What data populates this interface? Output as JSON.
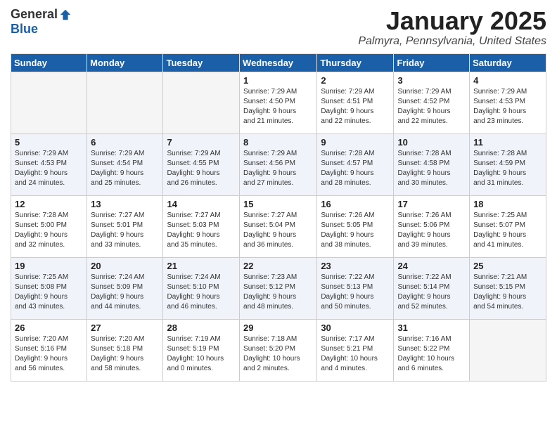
{
  "header": {
    "logo_general": "General",
    "logo_blue": "Blue",
    "month_title": "January 2025",
    "location": "Palmyra, Pennsylvania, United States"
  },
  "days_of_week": [
    "Sunday",
    "Monday",
    "Tuesday",
    "Wednesday",
    "Thursday",
    "Friday",
    "Saturday"
  ],
  "weeks": [
    {
      "shaded": false,
      "days": [
        {
          "num": "",
          "info": ""
        },
        {
          "num": "",
          "info": ""
        },
        {
          "num": "",
          "info": ""
        },
        {
          "num": "1",
          "info": "Sunrise: 7:29 AM\nSunset: 4:50 PM\nDaylight: 9 hours\nand 21 minutes."
        },
        {
          "num": "2",
          "info": "Sunrise: 7:29 AM\nSunset: 4:51 PM\nDaylight: 9 hours\nand 22 minutes."
        },
        {
          "num": "3",
          "info": "Sunrise: 7:29 AM\nSunset: 4:52 PM\nDaylight: 9 hours\nand 22 minutes."
        },
        {
          "num": "4",
          "info": "Sunrise: 7:29 AM\nSunset: 4:53 PM\nDaylight: 9 hours\nand 23 minutes."
        }
      ]
    },
    {
      "shaded": true,
      "days": [
        {
          "num": "5",
          "info": "Sunrise: 7:29 AM\nSunset: 4:53 PM\nDaylight: 9 hours\nand 24 minutes."
        },
        {
          "num": "6",
          "info": "Sunrise: 7:29 AM\nSunset: 4:54 PM\nDaylight: 9 hours\nand 25 minutes."
        },
        {
          "num": "7",
          "info": "Sunrise: 7:29 AM\nSunset: 4:55 PM\nDaylight: 9 hours\nand 26 minutes."
        },
        {
          "num": "8",
          "info": "Sunrise: 7:29 AM\nSunset: 4:56 PM\nDaylight: 9 hours\nand 27 minutes."
        },
        {
          "num": "9",
          "info": "Sunrise: 7:28 AM\nSunset: 4:57 PM\nDaylight: 9 hours\nand 28 minutes."
        },
        {
          "num": "10",
          "info": "Sunrise: 7:28 AM\nSunset: 4:58 PM\nDaylight: 9 hours\nand 30 minutes."
        },
        {
          "num": "11",
          "info": "Sunrise: 7:28 AM\nSunset: 4:59 PM\nDaylight: 9 hours\nand 31 minutes."
        }
      ]
    },
    {
      "shaded": false,
      "days": [
        {
          "num": "12",
          "info": "Sunrise: 7:28 AM\nSunset: 5:00 PM\nDaylight: 9 hours\nand 32 minutes."
        },
        {
          "num": "13",
          "info": "Sunrise: 7:27 AM\nSunset: 5:01 PM\nDaylight: 9 hours\nand 33 minutes."
        },
        {
          "num": "14",
          "info": "Sunrise: 7:27 AM\nSunset: 5:03 PM\nDaylight: 9 hours\nand 35 minutes."
        },
        {
          "num": "15",
          "info": "Sunrise: 7:27 AM\nSunset: 5:04 PM\nDaylight: 9 hours\nand 36 minutes."
        },
        {
          "num": "16",
          "info": "Sunrise: 7:26 AM\nSunset: 5:05 PM\nDaylight: 9 hours\nand 38 minutes."
        },
        {
          "num": "17",
          "info": "Sunrise: 7:26 AM\nSunset: 5:06 PM\nDaylight: 9 hours\nand 39 minutes."
        },
        {
          "num": "18",
          "info": "Sunrise: 7:25 AM\nSunset: 5:07 PM\nDaylight: 9 hours\nand 41 minutes."
        }
      ]
    },
    {
      "shaded": true,
      "days": [
        {
          "num": "19",
          "info": "Sunrise: 7:25 AM\nSunset: 5:08 PM\nDaylight: 9 hours\nand 43 minutes."
        },
        {
          "num": "20",
          "info": "Sunrise: 7:24 AM\nSunset: 5:09 PM\nDaylight: 9 hours\nand 44 minutes."
        },
        {
          "num": "21",
          "info": "Sunrise: 7:24 AM\nSunset: 5:10 PM\nDaylight: 9 hours\nand 46 minutes."
        },
        {
          "num": "22",
          "info": "Sunrise: 7:23 AM\nSunset: 5:12 PM\nDaylight: 9 hours\nand 48 minutes."
        },
        {
          "num": "23",
          "info": "Sunrise: 7:22 AM\nSunset: 5:13 PM\nDaylight: 9 hours\nand 50 minutes."
        },
        {
          "num": "24",
          "info": "Sunrise: 7:22 AM\nSunset: 5:14 PM\nDaylight: 9 hours\nand 52 minutes."
        },
        {
          "num": "25",
          "info": "Sunrise: 7:21 AM\nSunset: 5:15 PM\nDaylight: 9 hours\nand 54 minutes."
        }
      ]
    },
    {
      "shaded": false,
      "days": [
        {
          "num": "26",
          "info": "Sunrise: 7:20 AM\nSunset: 5:16 PM\nDaylight: 9 hours\nand 56 minutes."
        },
        {
          "num": "27",
          "info": "Sunrise: 7:20 AM\nSunset: 5:18 PM\nDaylight: 9 hours\nand 58 minutes."
        },
        {
          "num": "28",
          "info": "Sunrise: 7:19 AM\nSunset: 5:19 PM\nDaylight: 10 hours\nand 0 minutes."
        },
        {
          "num": "29",
          "info": "Sunrise: 7:18 AM\nSunset: 5:20 PM\nDaylight: 10 hours\nand 2 minutes."
        },
        {
          "num": "30",
          "info": "Sunrise: 7:17 AM\nSunset: 5:21 PM\nDaylight: 10 hours\nand 4 minutes."
        },
        {
          "num": "31",
          "info": "Sunrise: 7:16 AM\nSunset: 5:22 PM\nDaylight: 10 hours\nand 6 minutes."
        },
        {
          "num": "",
          "info": ""
        }
      ]
    }
  ]
}
